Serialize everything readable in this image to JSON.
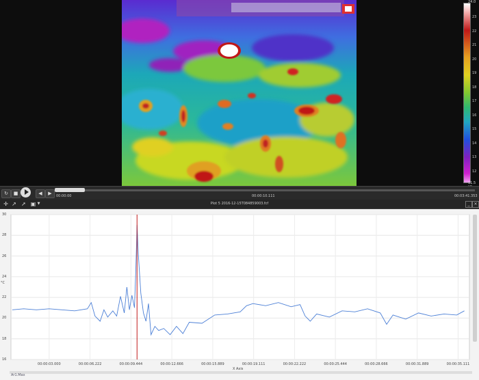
{
  "colorbar": {
    "max_label": "24.0",
    "min_label": "11.5 °C",
    "ticks": [
      "23",
      "22",
      "21",
      "20",
      "19",
      "18",
      "17",
      "16",
      "15",
      "14",
      "13",
      "12"
    ]
  },
  "controls": {
    "time_start": "00:00:00",
    "time_mid": "00:00:10.111",
    "time_end": "00:03:41.353"
  },
  "plot": {
    "title": "Plot 5 2016-12-15T084859003.fcf",
    "ylabel": "°C",
    "xlabel": "X Axis",
    "legend": "Ar1.Max"
  },
  "chart_data": {
    "type": "line",
    "ylim": [
      16,
      30
    ],
    "yticks": [
      "30",
      "28",
      "26",
      "24",
      "22",
      "20",
      "18",
      "16"
    ],
    "xticks": [
      "00:00:03.000",
      "00:00:06.222",
      "00:00:09.444",
      "00:00:12.666",
      "00:00:15.889",
      "00:00:19.111",
      "00:00:22.222",
      "00:00:25.444",
      "00:00:28.666",
      "00:00:31.889",
      "00:00:35.111"
    ],
    "cursor_x": 9.9,
    "series": [
      {
        "name": "Ar1.Max",
        "color": "#4b7fd6",
        "points": [
          [
            0.1,
            20.8
          ],
          [
            1,
            20.9
          ],
          [
            2,
            20.8
          ],
          [
            3,
            20.9
          ],
          [
            4,
            20.8
          ],
          [
            5,
            20.7
          ],
          [
            6,
            20.9
          ],
          [
            6.3,
            21.5
          ],
          [
            6.6,
            20.2
          ],
          [
            7,
            19.7
          ],
          [
            7.3,
            20.8
          ],
          [
            7.6,
            20.1
          ],
          [
            8,
            20.7
          ],
          [
            8.3,
            20.2
          ],
          [
            8.6,
            22.1
          ],
          [
            8.9,
            20.5
          ],
          [
            9.1,
            23.0
          ],
          [
            9.3,
            20.8
          ],
          [
            9.5,
            22.2
          ],
          [
            9.7,
            21.0
          ],
          [
            9.8,
            24.5
          ],
          [
            9.9,
            29.0
          ],
          [
            10.0,
            26.2
          ],
          [
            10.2,
            22.4
          ],
          [
            10.4,
            20.5
          ],
          [
            10.6,
            19.7
          ],
          [
            10.8,
            21.4
          ],
          [
            11.0,
            18.4
          ],
          [
            11.3,
            19.2
          ],
          [
            11.6,
            18.8
          ],
          [
            12,
            19.0
          ],
          [
            12.5,
            18.4
          ],
          [
            13,
            19.2
          ],
          [
            13.5,
            18.5
          ],
          [
            14,
            19.6
          ],
          [
            15,
            19.5
          ],
          [
            16,
            20.3
          ],
          [
            17,
            20.4
          ],
          [
            18,
            20.6
          ],
          [
            18.5,
            21.2
          ],
          [
            19,
            21.4
          ],
          [
            20,
            21.2
          ],
          [
            21,
            21.5
          ],
          [
            22,
            21.1
          ],
          [
            22.7,
            21.3
          ],
          [
            23.1,
            20.2
          ],
          [
            23.5,
            19.7
          ],
          [
            24,
            20.4
          ],
          [
            25,
            20.1
          ],
          [
            26,
            20.7
          ],
          [
            27,
            20.6
          ],
          [
            28,
            20.9
          ],
          [
            29,
            20.5
          ],
          [
            29.5,
            19.4
          ],
          [
            30,
            20.3
          ],
          [
            31,
            19.9
          ],
          [
            32,
            20.5
          ],
          [
            33,
            20.2
          ],
          [
            34,
            20.4
          ],
          [
            35,
            20.3
          ],
          [
            35.6,
            20.7
          ]
        ]
      }
    ]
  }
}
